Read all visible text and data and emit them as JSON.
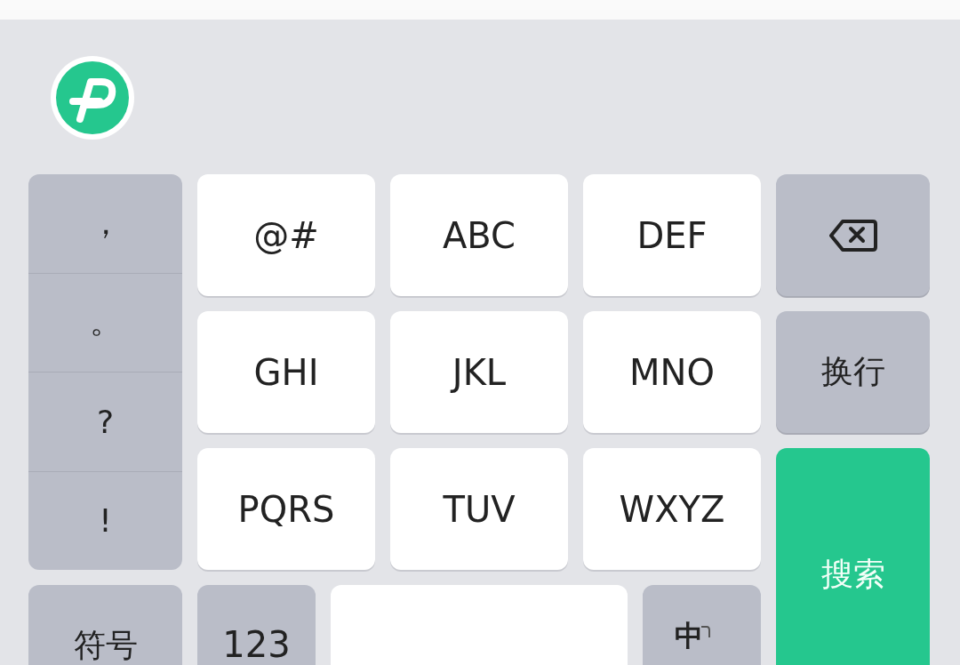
{
  "punctuation": [
    "，",
    "。",
    "?",
    "!"
  ],
  "letter_keys": [
    {
      "label": "@#"
    },
    {
      "label": "ABC"
    },
    {
      "label": "DEF"
    },
    {
      "label": "GHI"
    },
    {
      "label": "JKL"
    },
    {
      "label": "MNO"
    },
    {
      "label": "PQRS"
    },
    {
      "label": "TUV"
    },
    {
      "label": "WXYZ"
    }
  ],
  "enter_key": {
    "label": "换行"
  },
  "search_key": {
    "label": "搜索"
  },
  "bottom_row": {
    "symbols": "符号",
    "numbers": "123",
    "language": {
      "primary": "中"
    }
  }
}
